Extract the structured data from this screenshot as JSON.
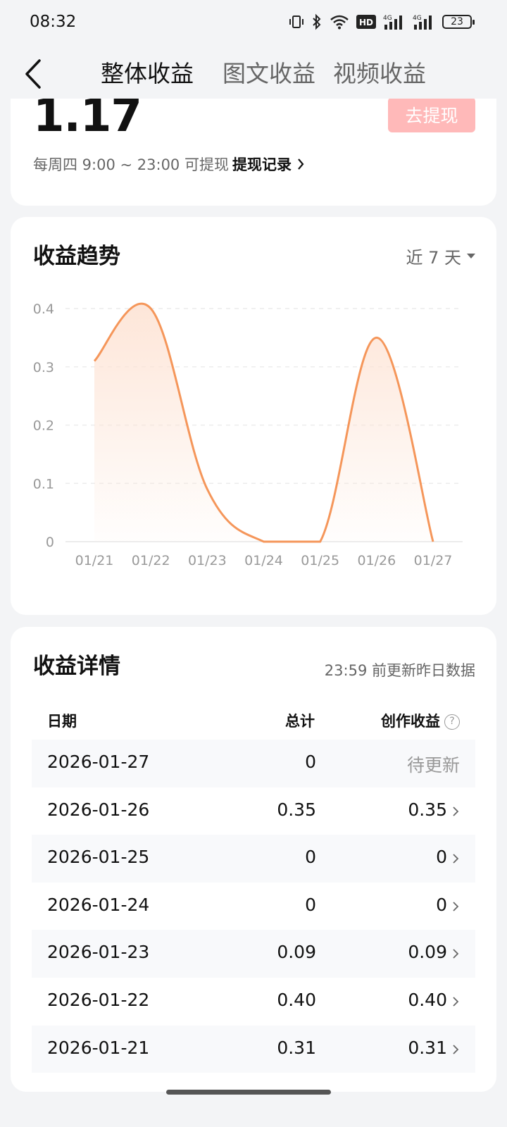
{
  "status_bar": {
    "time": "08:32",
    "battery": "23"
  },
  "nav": {
    "tabs": [
      {
        "label": "整体收益",
        "active": true
      },
      {
        "label": "图文收益",
        "active": false
      },
      {
        "label": "视频收益",
        "active": false
      }
    ]
  },
  "summary": {
    "amount": "1.17",
    "withdraw_button": "去提现",
    "withdraw_info": "每周四 9:00 ~ 23:00 可提现",
    "withdraw_record": "提现记录"
  },
  "trend": {
    "title": "收益趋势",
    "range": "近 7 天"
  },
  "chart_data": {
    "type": "area",
    "x": [
      "01/21",
      "01/22",
      "01/23",
      "01/24",
      "01/25",
      "01/26",
      "01/27"
    ],
    "values": [
      0.31,
      0.4,
      0.09,
      0,
      0,
      0.35,
      0
    ],
    "y_ticks": [
      "0",
      "0.1",
      "0.2",
      "0.3",
      "0.4"
    ],
    "ylim": [
      0,
      0.4
    ],
    "grid": true,
    "line_color": "#f5965a",
    "fill_color": "#fde3d4"
  },
  "detail": {
    "title": "收益详情",
    "update_note": "23:59 前更新昨日数据",
    "headers": {
      "date": "日期",
      "total": "总计",
      "earnings": "创作收益"
    },
    "rows": [
      {
        "date": "2026-01-27",
        "total": "0",
        "earnings": "待更新",
        "pending": true
      },
      {
        "date": "2026-01-26",
        "total": "0.35",
        "earnings": "0.35",
        "pending": false
      },
      {
        "date": "2026-01-25",
        "total": "0",
        "earnings": "0",
        "pending": false
      },
      {
        "date": "2026-01-24",
        "total": "0",
        "earnings": "0",
        "pending": false
      },
      {
        "date": "2026-01-23",
        "total": "0.09",
        "earnings": "0.09",
        "pending": false
      },
      {
        "date": "2026-01-22",
        "total": "0.40",
        "earnings": "0.40",
        "pending": false
      },
      {
        "date": "2026-01-21",
        "total": "0.31",
        "earnings": "0.31",
        "pending": false
      }
    ]
  },
  "colors": {
    "accent": "#f5965a",
    "withdraw_button": "#ffb9b9",
    "background": "#f3f4f6"
  }
}
